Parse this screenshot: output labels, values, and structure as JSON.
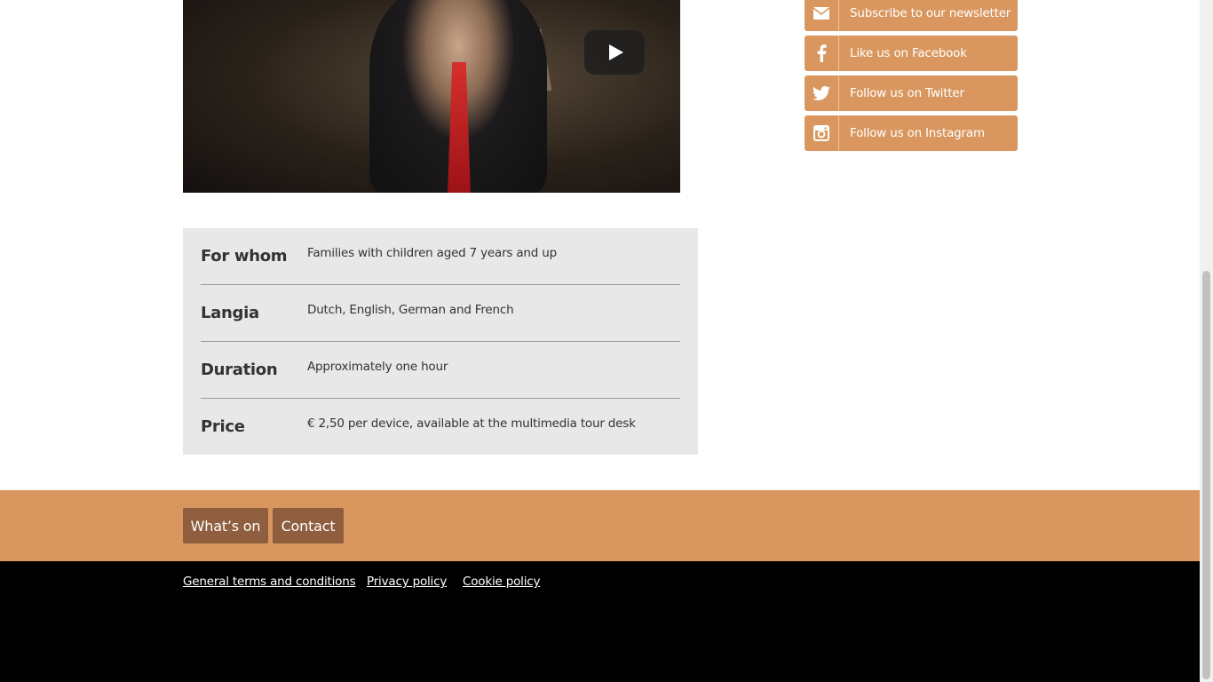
{
  "video": {
    "play_icon": "play-icon"
  },
  "info": {
    "rows": [
      {
        "label": "For whom",
        "value": "Families with children aged 7 years and up"
      },
      {
        "label": "Langia",
        "value": "Dutch, English, German and French"
      },
      {
        "label": "Duration",
        "value": "Approximately one hour"
      },
      {
        "label": "Price",
        "value": "€ 2,50 per device, available at the multimedia tour desk"
      }
    ]
  },
  "social": {
    "items": [
      {
        "label": "Subscribe to our newsletter",
        "icon": "envelope-icon"
      },
      {
        "label": "Like us on Facebook",
        "icon": "facebook-icon"
      },
      {
        "label": "Follow us on Twitter",
        "icon": "twitter-icon"
      },
      {
        "label": "Follow us on Instagram",
        "icon": "instagram-icon"
      }
    ]
  },
  "footer": {
    "nav": {
      "whats_on": "What’s on",
      "contact": "Contact"
    },
    "legal": {
      "terms": "General terms and conditions ",
      "privacy": "Privacy policy ",
      "cookie": "Cookie policy"
    }
  },
  "colors": {
    "accent": "#d9975f",
    "nav_button": "#8e5e3e",
    "info_bg": "#e8e8e8",
    "legal_bg": "#000000"
  }
}
